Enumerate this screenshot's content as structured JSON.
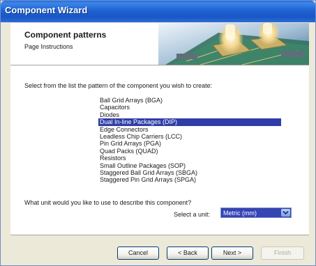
{
  "window": {
    "title": "Component Wizard"
  },
  "header": {
    "title": "Component patterns",
    "subtitle": "Page Instructions"
  },
  "content": {
    "prompt": "Select from the list the pattern of the component you wish to create:",
    "patterns": [
      {
        "label": "Ball Grid Arrays (BGA)",
        "selected": false
      },
      {
        "label": "Capacitors",
        "selected": false
      },
      {
        "label": "Diodes",
        "selected": false
      },
      {
        "label": "Dual In-line Packages (DIP)",
        "selected": true
      },
      {
        "label": "Edge Connectors",
        "selected": false
      },
      {
        "label": "Leadless Chip Carriers (LCC)",
        "selected": false
      },
      {
        "label": "Pin Grid Arrays (PGA)",
        "selected": false
      },
      {
        "label": "Quad Packs (QUAD)",
        "selected": false
      },
      {
        "label": "Resistors",
        "selected": false
      },
      {
        "label": "Small Outline Packages (SOP)",
        "selected": false
      },
      {
        "label": "Staggered Ball Grid Arrays (SBGA)",
        "selected": false
      },
      {
        "label": "Staggered Pin Grid Arrays (SPGA)",
        "selected": false
      }
    ],
    "unit_question": "What unit would you like to use to describe this component?",
    "unit_label": "Select a unit:",
    "unit_value": "Metric (mm)"
  },
  "buttons": {
    "cancel": "Cancel",
    "back": "< Back",
    "next": "Next >",
    "finish": "Finish"
  },
  "colors": {
    "title_bar": "#1f63d2",
    "selection": "#2f3da8",
    "dialog_bg": "#ece9d8"
  }
}
